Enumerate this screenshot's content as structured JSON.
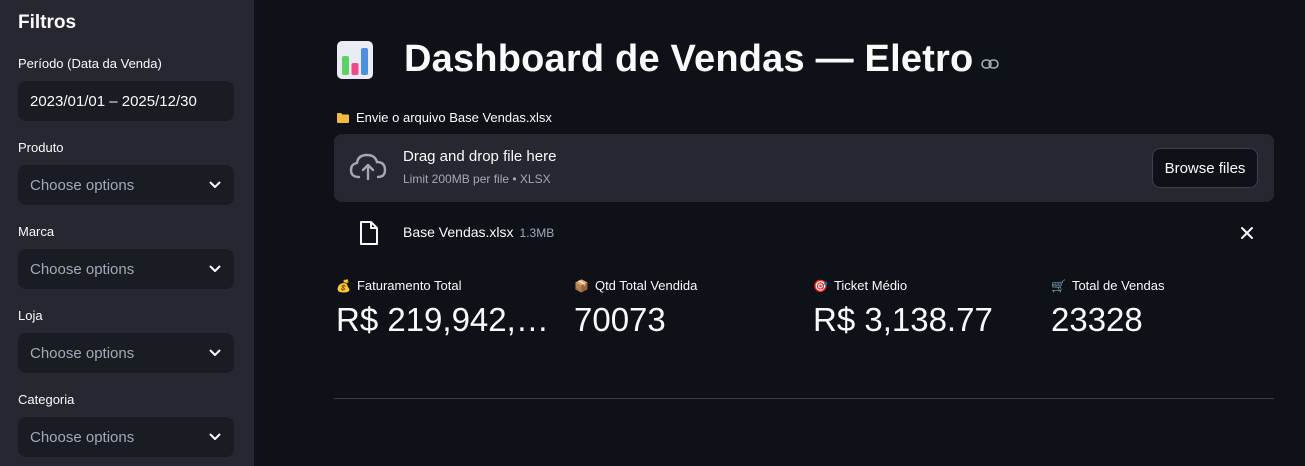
{
  "sidebar": {
    "title": "Filtros",
    "period": {
      "label": "Período (Data da Venda)",
      "value": "2023/01/01 – 2025/12/30"
    },
    "filters": [
      {
        "label": "Produto",
        "placeholder": "Choose options"
      },
      {
        "label": "Marca",
        "placeholder": "Choose options"
      },
      {
        "label": "Loja",
        "placeholder": "Choose options"
      },
      {
        "label": "Categoria",
        "placeholder": "Choose options"
      }
    ]
  },
  "main": {
    "title": "Dashboard de Vendas — Eletro",
    "upload_label": "Envie o arquivo Base Vendas.xlsx",
    "dropzone": {
      "main_text": "Drag and drop file here",
      "sub_text": "Limit 200MB per file • XLSX",
      "browse_label": "Browse files"
    },
    "file": {
      "name": "Base Vendas.xlsx",
      "size": "1.3MB"
    },
    "metrics": [
      {
        "emoji": "💰",
        "label": "Faturamento Total",
        "value": "R$ 219,942,9…"
      },
      {
        "emoji": "📦",
        "label": "Qtd Total Vendida",
        "value": "70073"
      },
      {
        "emoji": "🎯",
        "label": "Ticket Médio",
        "value": "R$ 3,138.77"
      },
      {
        "emoji": "🛒",
        "label": "Total de Vendas",
        "value": "23328"
      }
    ]
  },
  "colors": {
    "background": "#0e1117",
    "sidebar": "#262730",
    "input": "#1a1c24",
    "text": "#fafafa",
    "muted": "#a3a8b8"
  },
  "icons": {
    "title": "bar-chart-icon",
    "link": "link-icon",
    "folder": "folder-icon",
    "cloud": "cloud-upload-icon",
    "file": "file-icon",
    "close": "close-icon",
    "chevron": "chevron-down-icon"
  }
}
